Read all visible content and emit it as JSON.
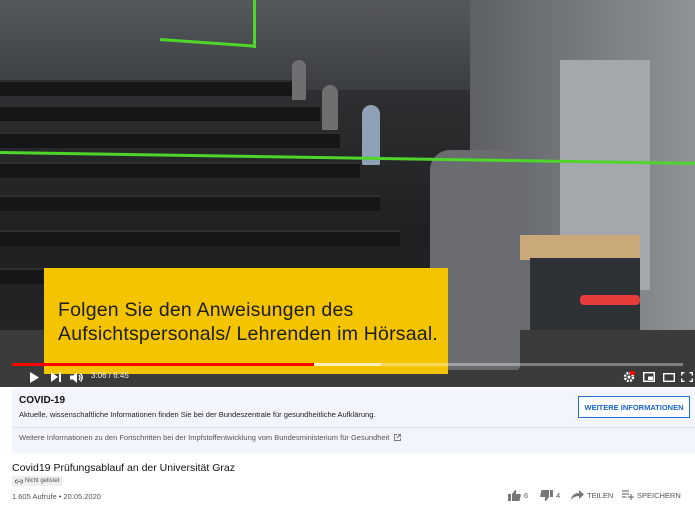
{
  "subtitle": {
    "line1": "Folgen Sie den Anweisungen des",
    "line2": "Aufsichtspersonals/ Lehrenden im Hörsaal."
  },
  "player": {
    "time": "3:06 / 6:45",
    "progress_fraction": 0.45,
    "buffer_fraction": 0.55,
    "icons": [
      "play-icon",
      "next-icon",
      "volume-icon",
      "settings-icon",
      "miniplayer-icon",
      "theater-icon",
      "fullscreen-icon"
    ]
  },
  "info_panel": {
    "title": "COVID-19",
    "description": "Aktuelle, wissenschaftliche Informationen finden Sie bei der Bundeszentrale für gesundheitliche Aufklärung.",
    "button": "WEITERE INFORMATIONEN",
    "link": "Weitere Informationen zu den Fortschritten bei der Impfstoffentwicklung vom Bundesministerium für Gesundheit"
  },
  "video": {
    "title": "Covid19 Prüfungsablauf an der Universität Graz",
    "badge": "Nicht gelistet",
    "meta": "1.605 Aufrufe • 20.05.2020",
    "likes": "6",
    "dislikes": "4",
    "share": "TEILEN",
    "save": "SPEICHERN"
  },
  "colors": {
    "subtitle_bg": "#f5c400",
    "progress": "#ff0000",
    "accent_blue": "#1a66c9",
    "annotation_green": "#4fd62a"
  }
}
